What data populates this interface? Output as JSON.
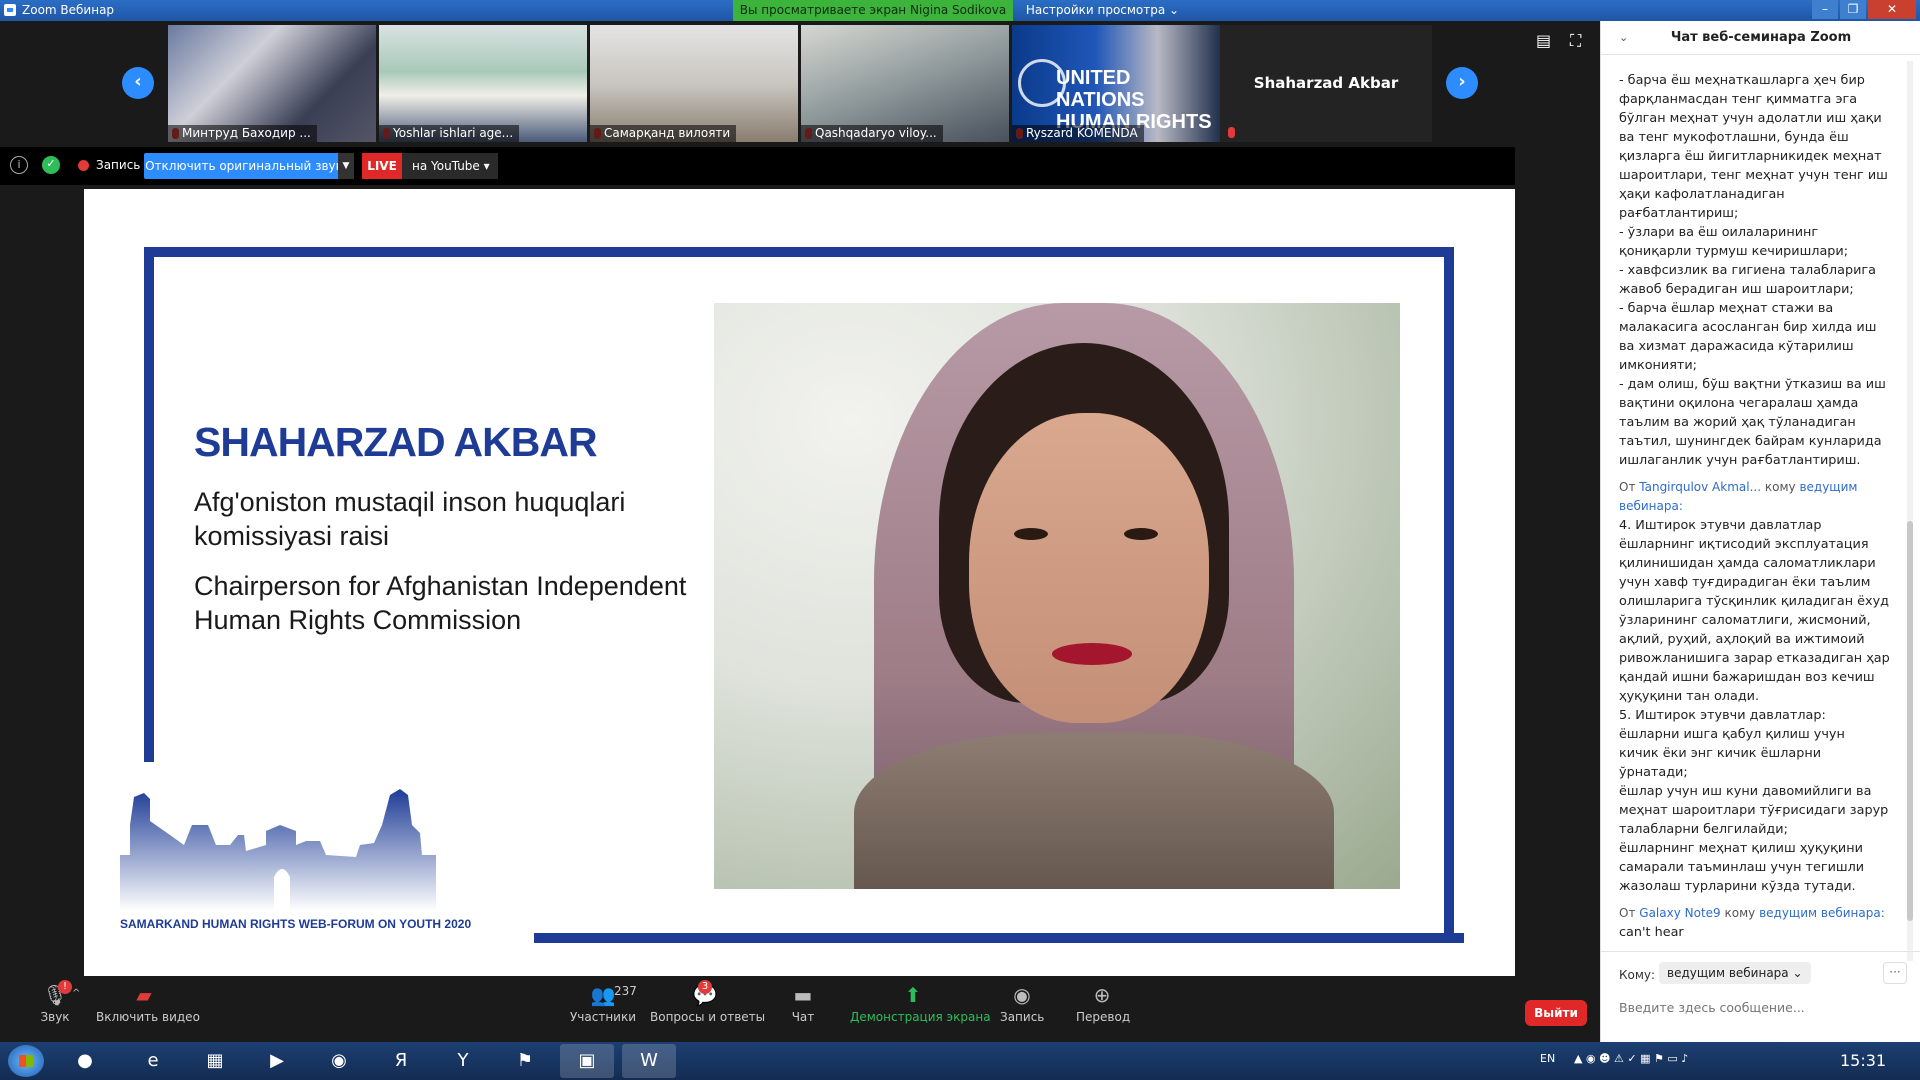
{
  "window": {
    "title": "Zoom Вебинар"
  },
  "banner": {
    "sharing": "Вы просматриваете экран Nigina Sodikova",
    "view_options": "Настройки просмотра ⌄"
  },
  "window_controls": {
    "minimize": "–",
    "maximize": "❐",
    "close": "✕"
  },
  "video_strip": {
    "prev": "‹",
    "next": "›",
    "participants": [
      {
        "name": "Минтруд Баходир ..."
      },
      {
        "name": "Yoshlar ishlari age..."
      },
      {
        "name": "Самарқанд вилояти"
      },
      {
        "name": "Qashqadaryo viloy..."
      },
      {
        "name": "Ryszard KOMENDA",
        "logo_text": "UNITED NATIONS HUMAN RIGHTS"
      }
    ],
    "active_speaker": "Shaharzad Akbar",
    "layout_icon": "▤",
    "fullscreen_icon": "⛶"
  },
  "recording_bar": {
    "info_icon": "i",
    "shield_icon": "✓",
    "recording_label": "Запись",
    "audio_button": "Отключить оригинальный звук",
    "audio_dropdown": "▼",
    "live_badge": "LIVE",
    "youtube": "на YouTube ▾"
  },
  "slide": {
    "name": "SHAHARZAD AKBAR",
    "subtitle_uz": "Afg'oniston mustaqil inson huquqlari komissiyasi raisi",
    "subtitle_en": "Chairperson for Afghanistan Independent Human Rights Commission",
    "forum": "SAMARKAND HUMAN RIGHTS WEB-FORUM ON YOUTH 2020",
    "brand_color": "#1e3c96"
  },
  "toolbar": {
    "audio": "Звук",
    "audio_badge": "!",
    "audio_caret": "^",
    "video": "Включить видео",
    "participants": "Участники",
    "participants_count": "237",
    "qa": "Вопросы и ответы",
    "qa_badge": "3",
    "chat": "Чат",
    "share": "Демонстрация экрана",
    "record": "Запись",
    "translate": "Перевод",
    "leave": "Выйти"
  },
  "chat": {
    "header": "Чат веб-семинара Zoom",
    "collapse": "⌄",
    "message1_lines": [
      "- барча ёш меҳнаткашларга ҳеч бир",
      "фарқланмасдан тенг қимматга эга",
      "бўлган меҳнат учун адолатли иш ҳақи",
      "ва тенг мукофотлашни, бунда ёш",
      "қизларга ёш йигитларникидек меҳнат",
      "шароитлари, тенг меҳнат учун тенг иш",
      "ҳақи кафолатланадиган",
      "рағбатлантириш;",
      "- ўзлари ва ёш оилаларининг",
      "қониқарли турмуш кечиришлари;",
      "- хавфсизлик ва гигиена талабларига",
      "жавоб берадиган иш шароитлари;",
      "- барча ёшлар меҳнат стажи ва",
      "малакасига асосланган бир хилда иш",
      "ва хизмат даражасида кўтарилиш",
      "имконияти;",
      "- дам олиш, бўш вақтни ўтказиш ва иш",
      "вақтини оқилона чегаралаш ҳамда",
      "таълим ва жорий ҳақ тўланадиган",
      "таътил, шунингдек байрам кунларида",
      "ишлаганлик учун рағбатлантириш."
    ],
    "message2": {
      "from_prefix": "От",
      "from": "Tangirqulov Akmal...",
      "to_prefix": "кому",
      "to": "ведущим вебинара:",
      "lines": [
        "4. Иштирок этувчи давлатлар",
        "ёшларнинг иқтисодий эксплуатация",
        "қилинишидан ҳамда саломатликлари",
        "учун хавф туғдирадиган ёки таълим",
        "олишларига тўсқинлик қиладиган ёхуд",
        "ўзларининг саломатлиги, жисмоний,",
        "ақлий, руҳий, аҳлоқий ва ижтимоий",
        "ривожланишига зарар етказадиган ҳар",
        "қандай ишни бажаришдан воз кечиш",
        "ҳуқуқини тан олади.",
        "5. Иштирок этувчи давлатлар:",
        "ёшларни ишга қабул қилиш учун",
        "кичик ёки энг кичик ёшларни",
        "ўрнатади;",
        "ёшлар учун иш куни давомийлиги ва",
        "меҳнат шароитлари тўғрисидаги зарур",
        "талабларни белгилайди;",
        "ёшларнинг меҳнат қилиш ҳуқуқини",
        "самарали таъминлаш учун тегишли",
        "жазолаш турларини кўзда тутади."
      ]
    },
    "message3": {
      "from_prefix": "От",
      "from": "Galaxy Note9",
      "to_prefix": "кому",
      "to": "ведущим вебинара:",
      "text": "can't hear"
    },
    "to_label": "Кому:",
    "to_value": "ведущим вебинара ⌄",
    "more": "···",
    "input_placeholder": "Введите здесь сообщение..."
  },
  "taskbar": {
    "lang": "EN",
    "clock": "15:31",
    "apps": [
      {
        "icon": "browser-icon",
        "glyph": "●"
      },
      {
        "icon": "ie-icon",
        "glyph": "e"
      },
      {
        "icon": "folder-icon",
        "glyph": "▦"
      },
      {
        "icon": "media-icon",
        "glyph": "▶"
      },
      {
        "icon": "chrome-icon",
        "glyph": "◉"
      },
      {
        "icon": "yandex-icon",
        "glyph": "Я"
      },
      {
        "icon": "yandex-browser-icon",
        "glyph": "Y"
      },
      {
        "icon": "pdf-icon",
        "glyph": "⚑"
      },
      {
        "icon": "zoom-icon",
        "glyph": "▣"
      },
      {
        "icon": "word-icon",
        "glyph": "W"
      }
    ]
  }
}
